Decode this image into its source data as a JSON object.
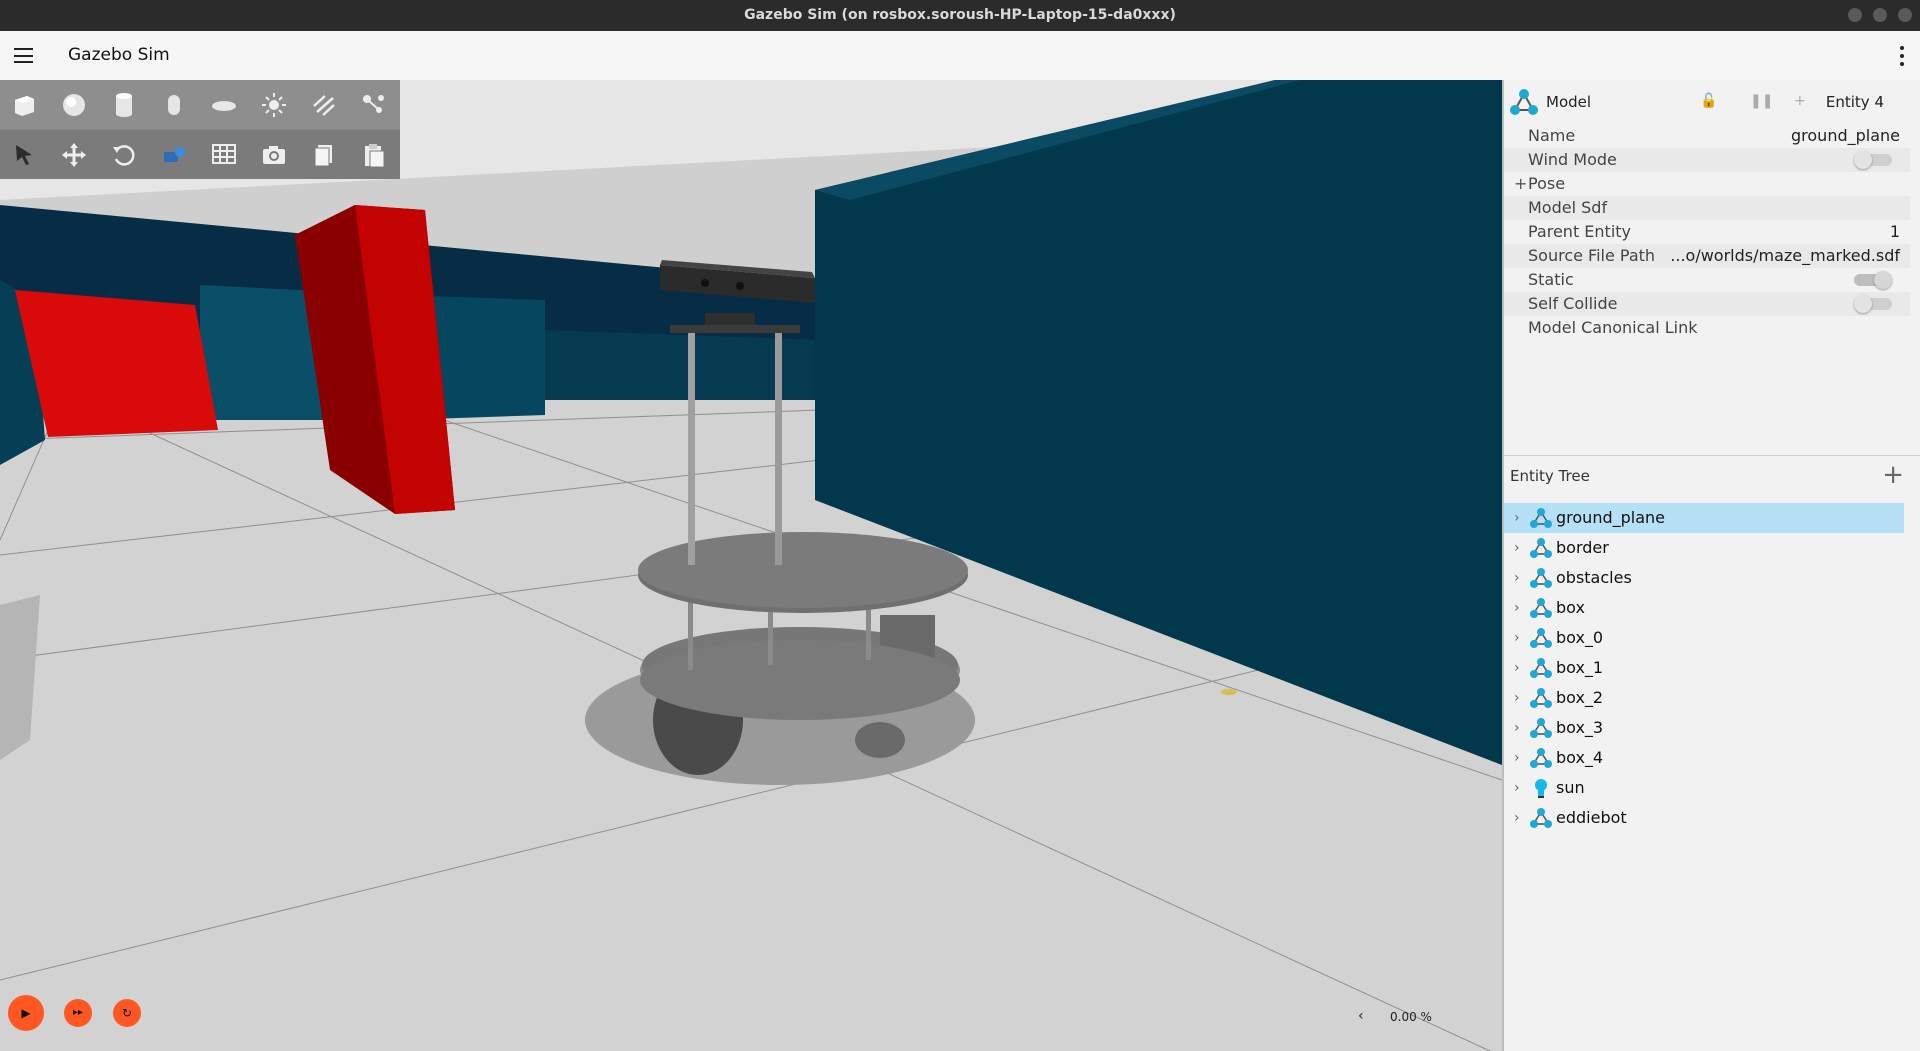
{
  "window": {
    "title": "Gazebo Sim (on rosbox.soroush-HP-Laptop-15-da0xxx)"
  },
  "appbar": {
    "title": "Gazebo Sim"
  },
  "toolbar": {
    "row1": [
      "box-icon",
      "sphere-icon",
      "cylinder-icon",
      "capsule-icon",
      "ellipsoid-icon",
      "sun-light-icon",
      "directional-light-icon",
      "spot-light-icon"
    ],
    "row2": [
      "select-cursor-icon",
      "translate-icon",
      "rotate-icon",
      "view-angle-icon",
      "grid-snap-icon",
      "screenshot-camera-icon",
      "copy-icon",
      "paste-icon"
    ]
  },
  "playback": {
    "play": "▶",
    "step": "▸▸",
    "reset": "↻"
  },
  "rtf": {
    "arrow": "‹",
    "value": "0.00 %"
  },
  "component_inspector": {
    "type": "Model",
    "entity": "Entity 4",
    "props": [
      {
        "key": "Name",
        "value": "ground_plane"
      },
      {
        "key": "Wind Mode",
        "toggle": false
      },
      {
        "key": "Pose",
        "expandable": true
      },
      {
        "key": "Model Sdf",
        "value": ""
      },
      {
        "key": "Parent Entity",
        "value": "1"
      },
      {
        "key": "Source File Path",
        "value": "...o/worlds/maze_marked.sdf"
      },
      {
        "key": "Static",
        "toggle": true
      },
      {
        "key": "Self Collide",
        "toggle": false
      },
      {
        "key": "Model Canonical Link",
        "value": ""
      }
    ],
    "pose_prefix": "+"
  },
  "entity_tree": {
    "title": "Entity Tree",
    "add": "+",
    "items": [
      {
        "name": "ground_plane",
        "kind": "model",
        "selected": true
      },
      {
        "name": "border",
        "kind": "model"
      },
      {
        "name": "obstacles",
        "kind": "model"
      },
      {
        "name": "box",
        "kind": "model"
      },
      {
        "name": "box_0",
        "kind": "model"
      },
      {
        "name": "box_1",
        "kind": "model"
      },
      {
        "name": "box_2",
        "kind": "model"
      },
      {
        "name": "box_3",
        "kind": "model"
      },
      {
        "name": "box_4",
        "kind": "model"
      },
      {
        "name": "sun",
        "kind": "light"
      },
      {
        "name": "eddiebot",
        "kind": "model"
      }
    ]
  },
  "colors": {
    "accent": "#ff5722",
    "selection": "#b6e0f5",
    "wall": "#013a4c",
    "obstacle": "#c40000"
  }
}
